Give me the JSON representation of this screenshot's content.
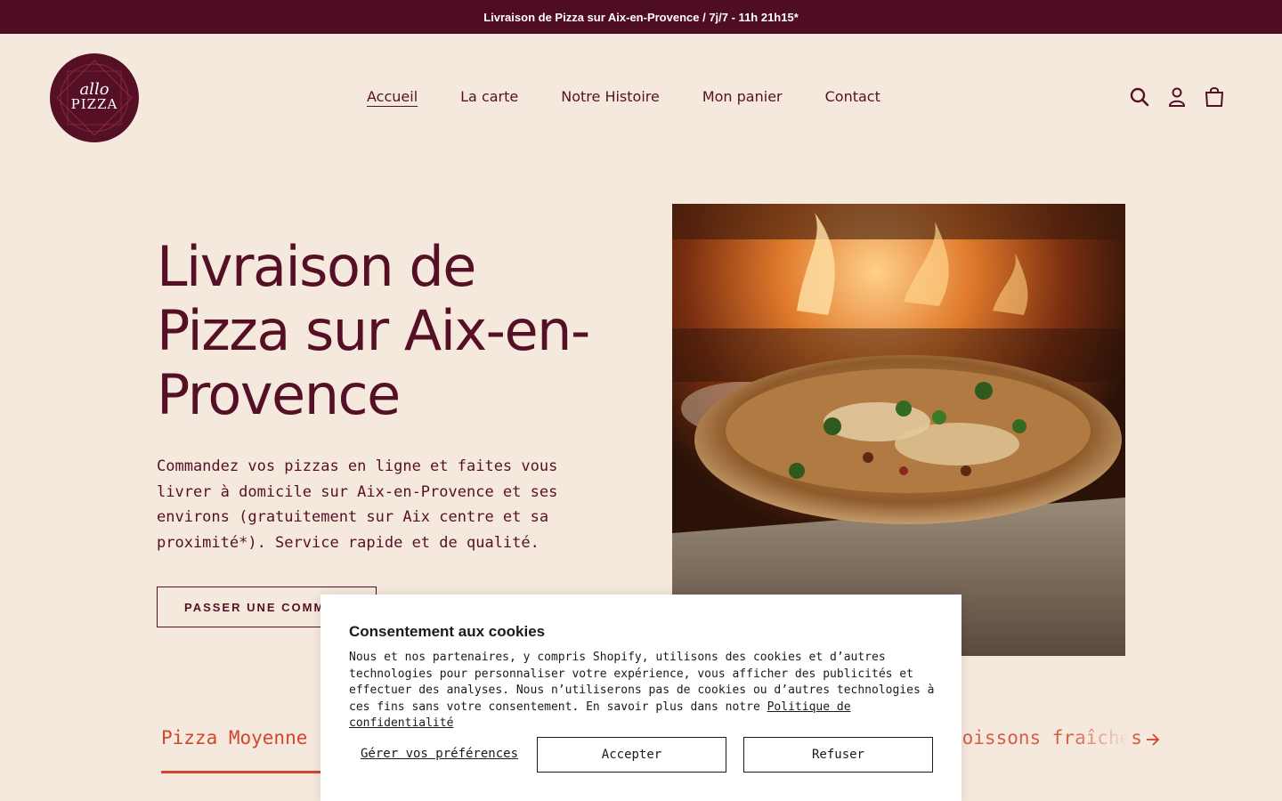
{
  "announcement": "Livraison de Pizza sur Aix-en-Provence / 7j/7 - 11h 21h15*",
  "logo": {
    "line1": "allo",
    "line2": "PIZZA"
  },
  "nav": {
    "items": [
      {
        "label": "Accueil",
        "active": true
      },
      {
        "label": "La carte"
      },
      {
        "label": "Notre Histoire"
      },
      {
        "label": "Mon panier"
      },
      {
        "label": "Contact"
      }
    ]
  },
  "header_icons": [
    "search-icon",
    "account-icon",
    "cart-icon"
  ],
  "hero": {
    "title": "Livraison de Pizza sur Aix-en-Provence",
    "text": "Commandez vos pizzas en ligne et faites vous livrer à domicile sur Aix-en-Provence et ses environs (gratuitement sur Aix centre et sa proximité*). Service rapide et de qualité.",
    "cta": "PASSER UNE COMMANDE"
  },
  "tabs": {
    "first": "Pizza Moyenne (",
    "last": "Boissons fraîches"
  },
  "cookie": {
    "title": "Consentement aux cookies",
    "text": "Nous et nos partenaires, y compris Shopify, utilisons des cookies et d’autres technologies pour personnaliser votre expérience, vous afficher des publicités et effectuer des analyses. Nous n’utiliserons pas de cookies ou d’autres technologies à ces fins sans votre consentement. En savoir plus dans notre",
    "policy_link": "Politique de confidentialité",
    "manage": "Gérer vos préférences",
    "accept": "Accepter",
    "refuse": "Refuser"
  },
  "colors": {
    "brand": "#561026",
    "announcement_bg": "#4f0d22",
    "page_bg": "#f5e9de",
    "accent": "#d4452e"
  }
}
